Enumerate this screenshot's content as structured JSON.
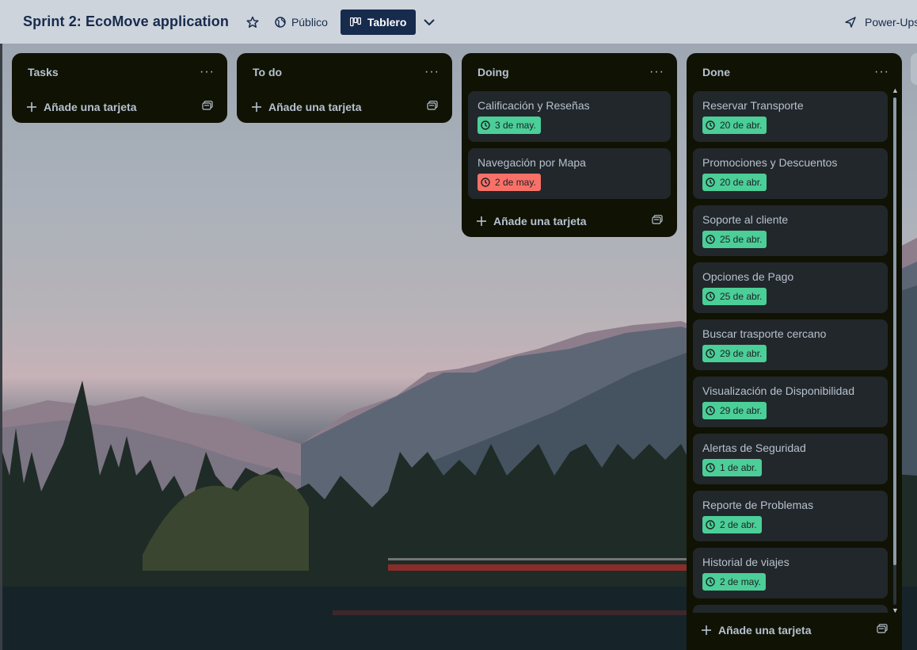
{
  "header": {
    "board_title": "Sprint 2: EcoMove application",
    "visibility_label": "Público",
    "view_label": "Tablero",
    "powerups_label": "Power-Ups"
  },
  "lists": [
    {
      "title": "Tasks",
      "add_label": "Añade una tarjeta",
      "cards": []
    },
    {
      "title": "To do",
      "add_label": "Añade una tarjeta",
      "cards": []
    },
    {
      "title": "Doing",
      "add_label": "Añade una tarjeta",
      "cards": [
        {
          "title": "Calificación y Reseñas",
          "due": "3 de may.",
          "status": "green"
        },
        {
          "title": "Navegación por Mapa",
          "due": "2 de may.",
          "status": "red"
        }
      ]
    },
    {
      "title": "Done",
      "add_label": "Añade una tarjeta",
      "cards": [
        {
          "title": "Reservar Transporte",
          "due": "20 de abr.",
          "status": "green"
        },
        {
          "title": "Promociones y Descuentos",
          "due": "20 de abr.",
          "status": "green"
        },
        {
          "title": "Soporte al cliente",
          "due": "25 de abr.",
          "status": "green"
        },
        {
          "title": "Opciones de Pago",
          "due": "25 de abr.",
          "status": "green"
        },
        {
          "title": "Buscar trasporte cercano",
          "due": "29 de abr.",
          "status": "green"
        },
        {
          "title": "Visualización de Disponibilidad",
          "due": "29 de abr.",
          "status": "green"
        },
        {
          "title": "Alertas de Seguridad",
          "due": "1 de abr.",
          "status": "green"
        },
        {
          "title": "Reporte de Problemas",
          "due": "2 de abr.",
          "status": "green"
        },
        {
          "title": "Historial de viajes",
          "due": "2 de may.",
          "status": "green"
        }
      ]
    }
  ],
  "colors": {
    "list_bg": "#101204",
    "card_bg": "#22272b",
    "due_green": "#4bce97",
    "due_red": "#f87168",
    "header_button": "#172b4d"
  }
}
